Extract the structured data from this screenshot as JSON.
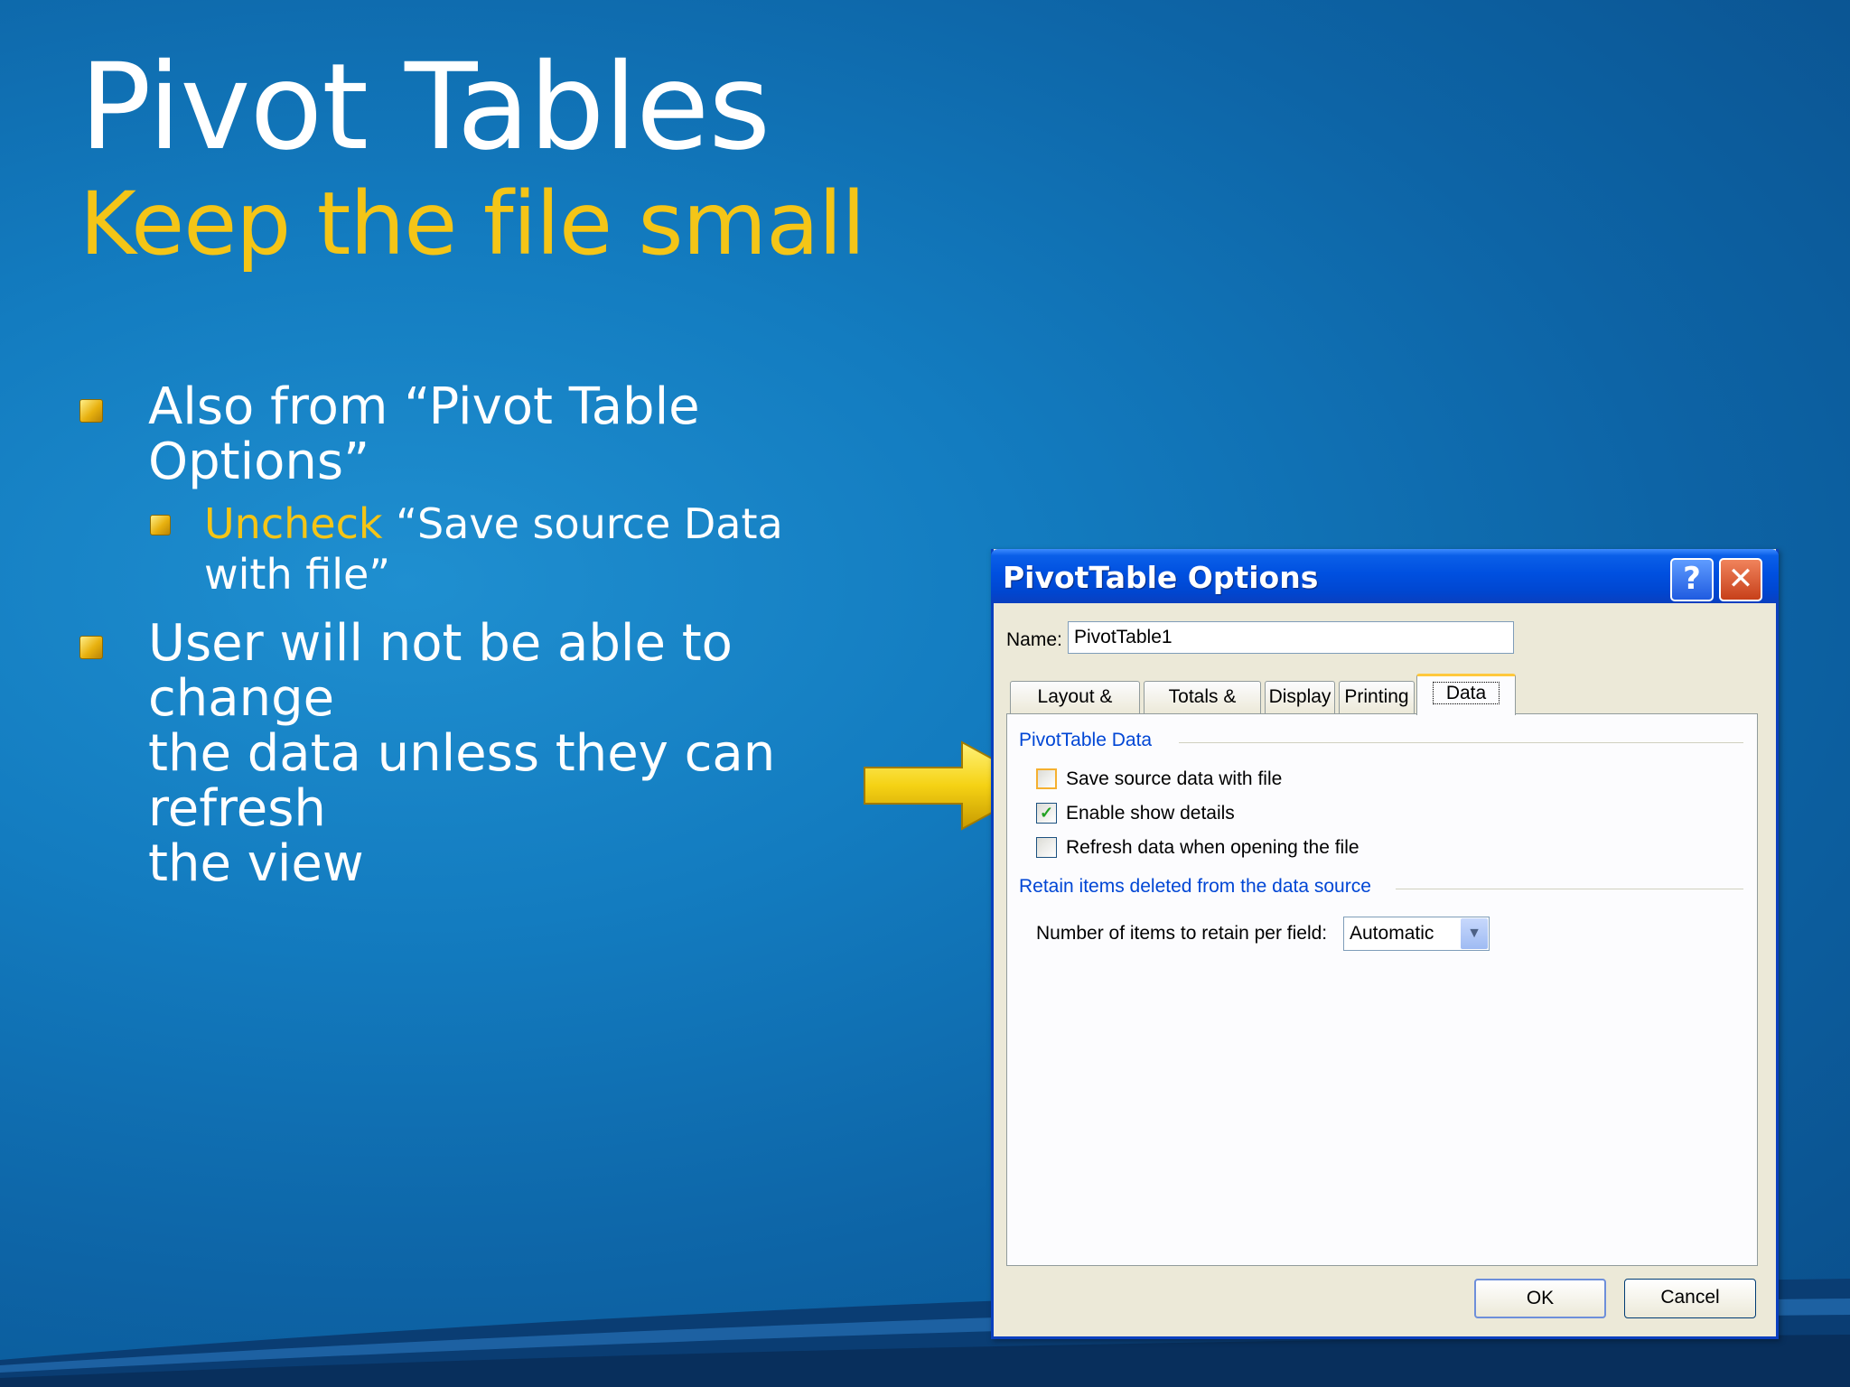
{
  "slide": {
    "title": "Pivot Tables",
    "subtitle": "Keep the file small",
    "bullets": [
      {
        "text": "Also from “Pivot Table Options”"
      },
      {
        "highlight": "Uncheck",
        "text_line1": "“Save source Data",
        "text_line2": "with file”"
      },
      {
        "line1": "User will not be able to change",
        "line2": "the data unless they can refresh",
        "line3": "the view"
      }
    ]
  },
  "dialog": {
    "title": "PivotTable Options",
    "help_symbol": "?",
    "close_symbol": "✕",
    "name_label": "Name:",
    "name_value": "PivotTable1",
    "tabs": [
      "Layout & Format",
      "Totals & Filters",
      "Display",
      "Printing",
      "Data"
    ],
    "active_tab": "Data",
    "group1": {
      "label": "PivotTable Data",
      "options": [
        {
          "label": "Save source data with file",
          "checked": false
        },
        {
          "label": "Enable show details",
          "checked": true
        },
        {
          "label": "Refresh data when opening the file",
          "checked": false
        }
      ]
    },
    "group2": {
      "label": "Retain items deleted from the data source",
      "field_label": "Number of items to retain per field:",
      "field_value": "Automatic"
    },
    "check_glyph": "✓",
    "dropdown_glyph": "▼",
    "ok_label": "OK",
    "cancel_label": "Cancel"
  },
  "colors": {
    "accent_yellow": "#f4c517",
    "titlebar_blue": "#0050e0",
    "group_label_blue": "#0046d5"
  },
  "icons": [
    "yellow-arrow-icon",
    "help-icon",
    "close-icon",
    "checkbox-icon",
    "dropdown-arrow-icon",
    "bullet-square-icon"
  ]
}
